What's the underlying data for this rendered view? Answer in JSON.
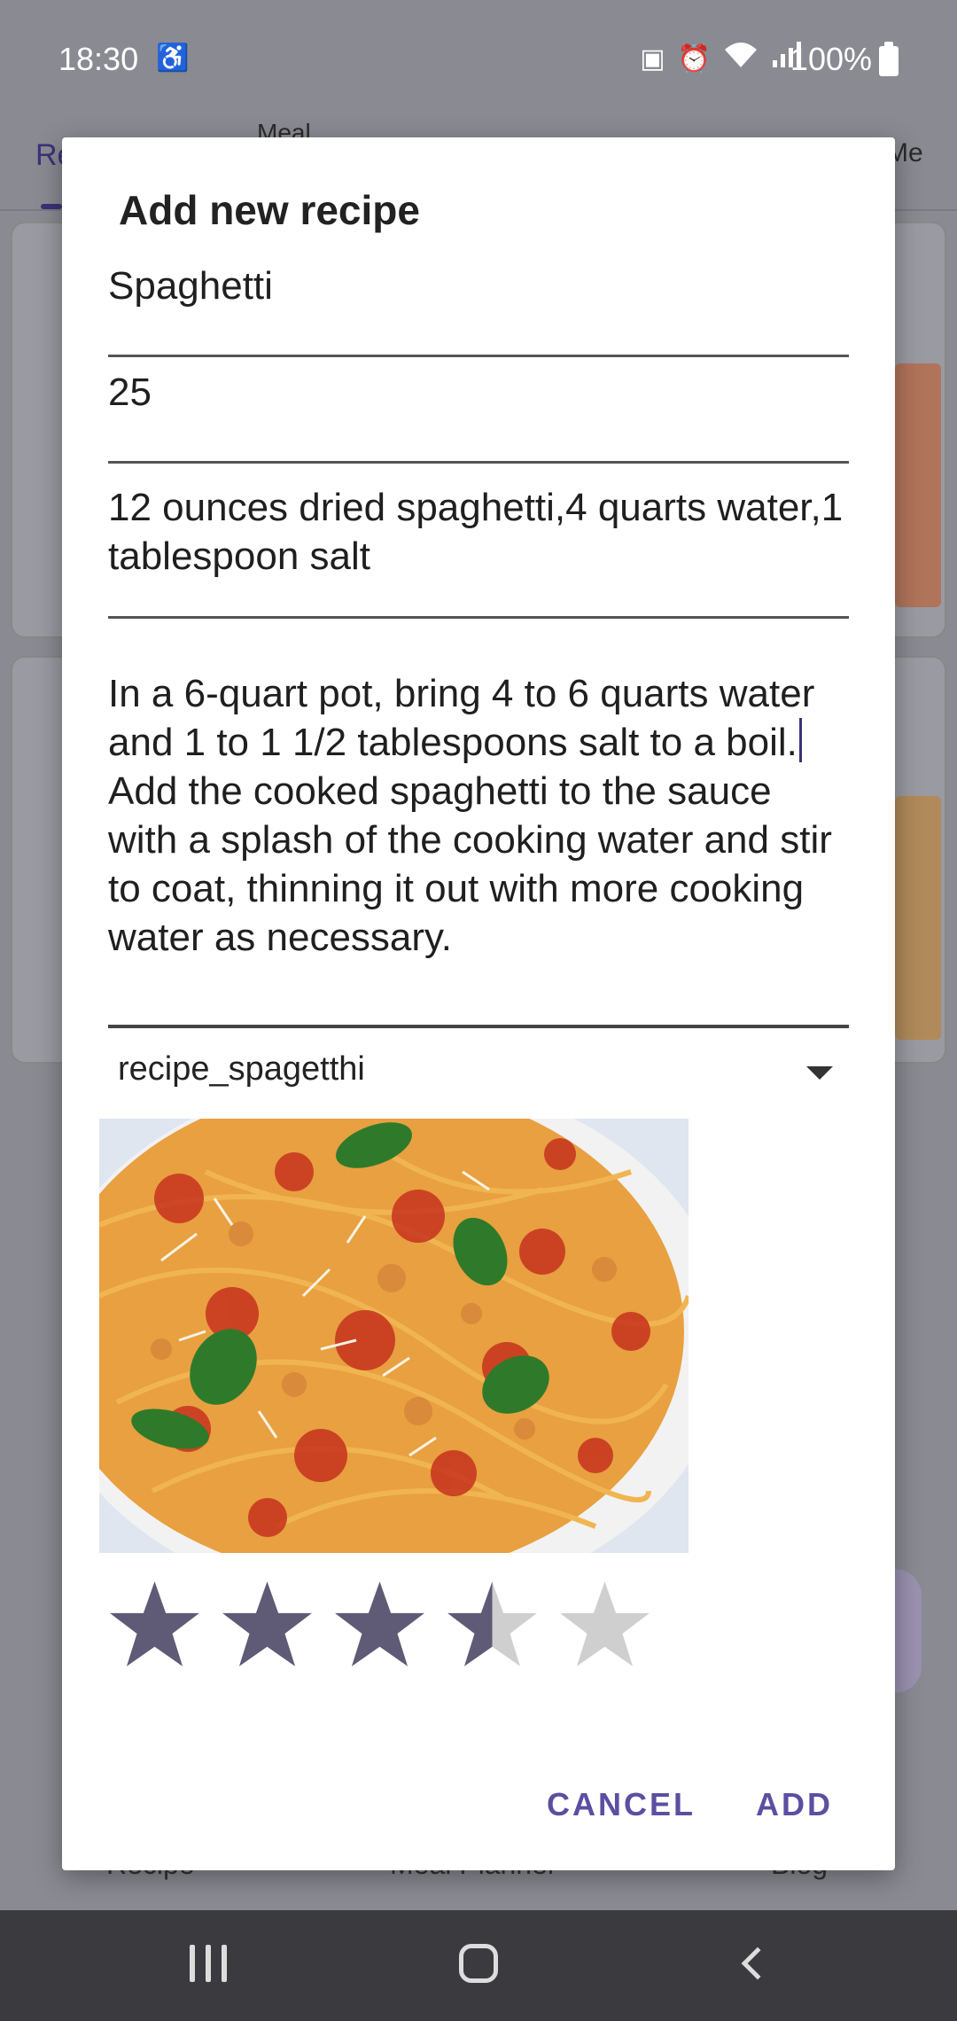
{
  "status_bar": {
    "time": "18:30",
    "battery": "100%"
  },
  "background": {
    "tabs": [
      "Re",
      "Meal",
      "Me"
    ],
    "bottom_nav": [
      "Recipe",
      "Meal Planner",
      "Blog"
    ]
  },
  "dialog": {
    "title": "Add new recipe",
    "name_value": "Spaghetti",
    "time_value": "25",
    "ingredients_value": "12 ounces dried spaghetti,4 quarts water,1 tablespoon salt",
    "instructions_line1": "In a 6-quart pot, bring 4 to 6 quarts water and 1 to 1 1/2 tablespoons salt to a boil.",
    "instructions_line2": "Add the cooked spaghetti to the sauce with a splash of the cooking water and stir to coat, thinning it out with more cooking water as necessary.",
    "image_selector": "recipe_spagetthi",
    "rating": 3.5,
    "rating_max": 5,
    "cancel_label": "CANCEL",
    "add_label": "ADD"
  },
  "colors": {
    "accent": "#5b4fa1",
    "star_filled": "#5f5a75",
    "star_empty": "#cfcfcf"
  }
}
